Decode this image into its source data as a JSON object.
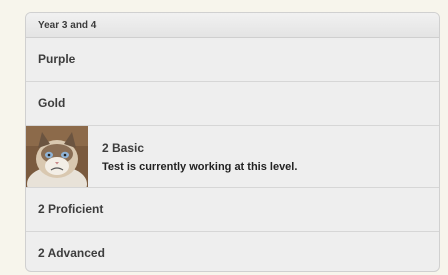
{
  "section": {
    "title": "Year 3 and 4"
  },
  "levels": [
    {
      "label": "Purple"
    },
    {
      "label": "Gold"
    },
    {
      "label": "2 Basic",
      "status": "Test is currently working at this level."
    },
    {
      "label": "2 Proficient"
    },
    {
      "label": "2 Advanced"
    }
  ],
  "colors": {
    "panel": "#eeeeee",
    "page_bg": "#f7f5ec",
    "divider": "#d6d6d6"
  }
}
